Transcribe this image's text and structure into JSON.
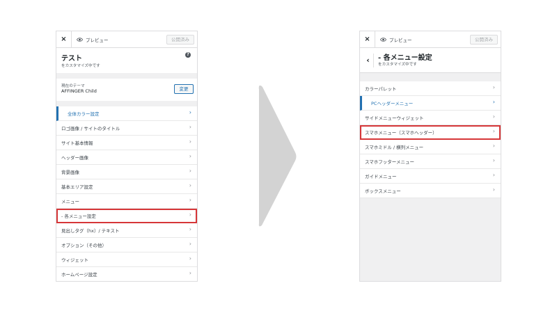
{
  "colors": {
    "accent": "#2271b1",
    "highlight": "#d63638",
    "arrow": "#d3d3d3"
  },
  "left": {
    "close_icon": "×",
    "preview_label": "プレビュー",
    "published_label": "公開済み",
    "title": "テスト",
    "subtitle": "をカスタマイズ中です",
    "help_icon": "?",
    "theme_label": "現在のテーマ",
    "theme_name": "AFFINGER Child",
    "change_label": "変更",
    "items": [
      {
        "label": "全体カラー設定"
      },
      {
        "label": "ロゴ画像 / サイトのタイトル"
      },
      {
        "label": "サイト基本情報"
      },
      {
        "label": "ヘッダー画像"
      },
      {
        "label": "背景画像"
      },
      {
        "label": "基本エリア設定"
      },
      {
        "label": "メニュー"
      },
      {
        "label": "- 各メニュー設定"
      },
      {
        "label": "見出しタグ（hx）/ テキスト"
      },
      {
        "label": "オプション（その他）"
      },
      {
        "label": "ウィジェット"
      },
      {
        "label": "ホームページ設定"
      }
    ]
  },
  "right": {
    "close_icon": "×",
    "preview_label": "プレビュー",
    "published_label": "公開済み",
    "back_icon": "‹",
    "title": "- 各メニュー設定",
    "subtitle": "をカスタマイズ中です",
    "items": [
      {
        "label": "カラーパレット"
      },
      {
        "label": "PCヘッダーメニュー"
      },
      {
        "label": "サイドメニューウィジェット"
      },
      {
        "label": "スマホメニュー（スマホヘッダー）"
      },
      {
        "label": "スマホミドル / 横列メニュー"
      },
      {
        "label": "スマホフッターメニュー"
      },
      {
        "label": "ガイドメニュー"
      },
      {
        "label": "ボックスメニュー"
      }
    ]
  },
  "chevron": "›"
}
